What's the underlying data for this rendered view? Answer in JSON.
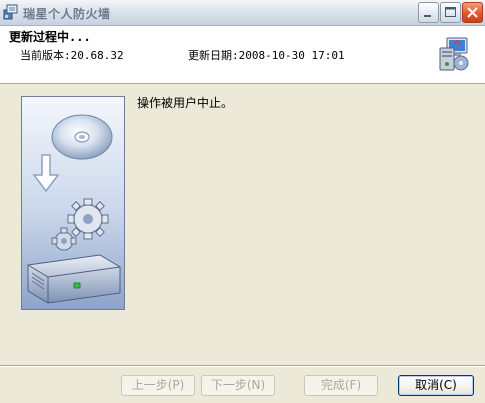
{
  "window": {
    "title": "瑞星个人防火墙"
  },
  "header": {
    "title": "更新过程中...",
    "current_version": "当前版本:20.68.32",
    "update_date": "更新日期:2008-10-30 17:01"
  },
  "main": {
    "message": "操作被用户中止。"
  },
  "buttons": {
    "prev": "上一步(P)",
    "next": "下一步(N)",
    "finish": "完成(F)",
    "cancel": "取消(C)"
  },
  "colors": {
    "window_bg": "#ECE9D8",
    "header_bg": "#FFFFFF",
    "close_button": "#E2572F",
    "disabled_text": "#ACA899",
    "default_button_border": "#003C74"
  },
  "icons": {
    "app": "app-icon",
    "header": "update-computer-icon",
    "side": "cd-drive-gears-art"
  },
  "state": {
    "prev_enabled": false,
    "next_enabled": false,
    "finish_enabled": false,
    "cancel_enabled": true
  }
}
